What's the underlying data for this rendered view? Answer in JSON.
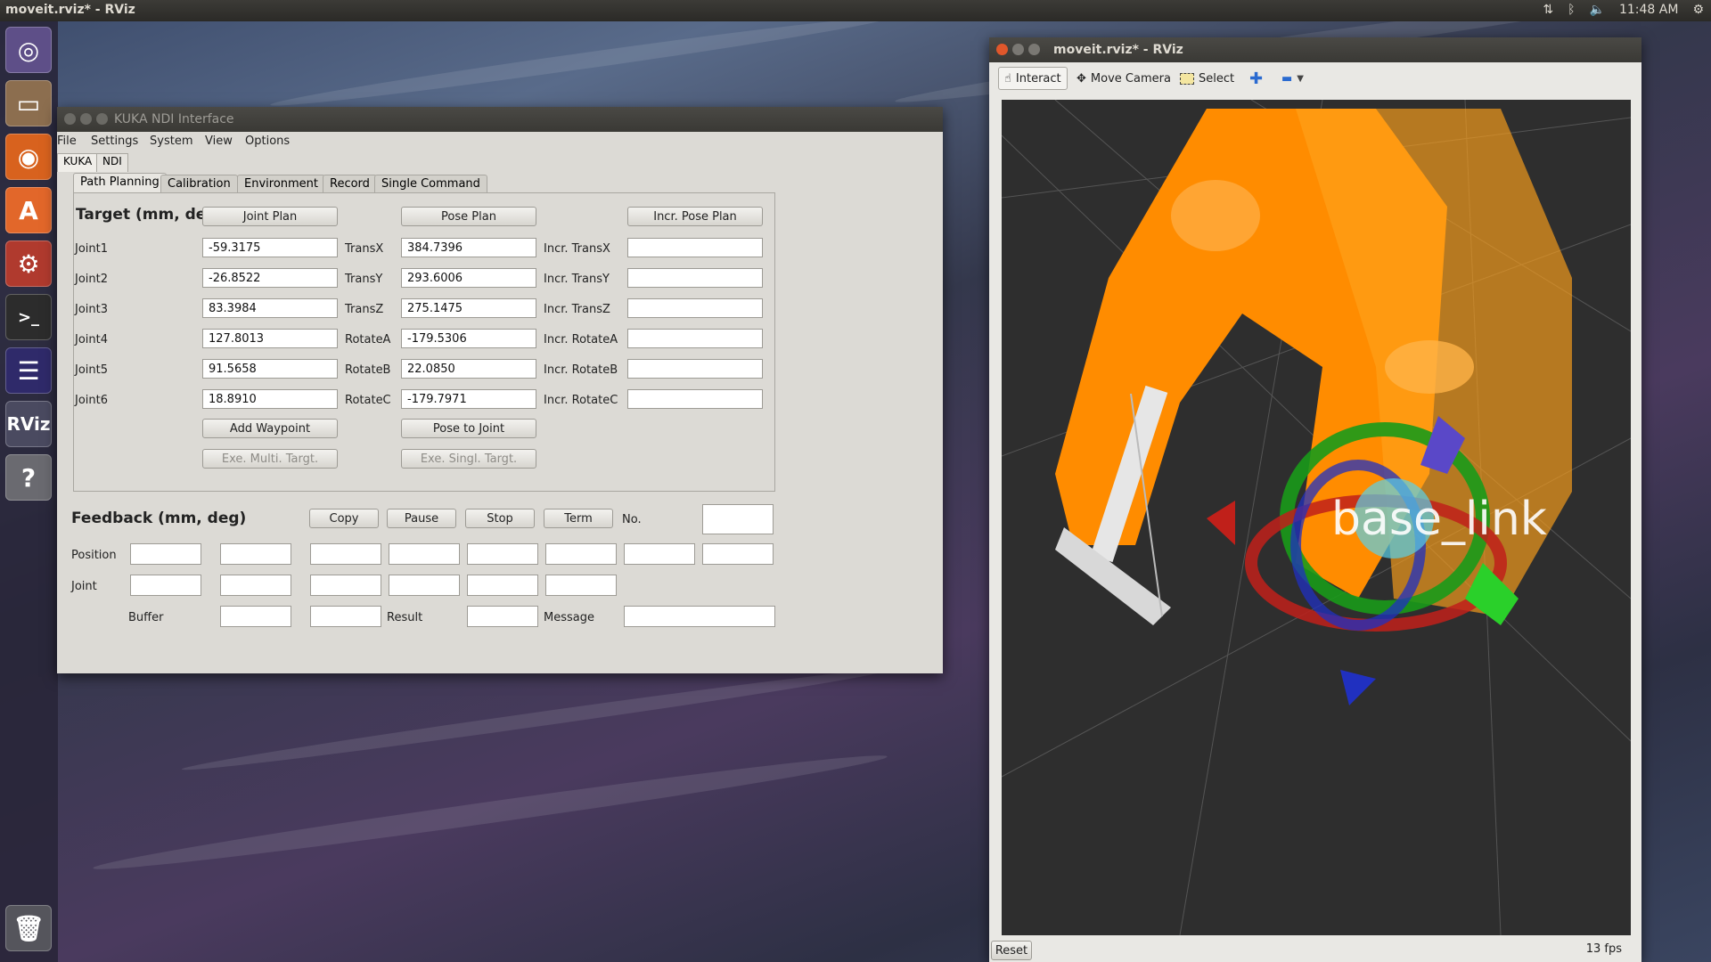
{
  "topbar": {
    "active_app": "moveit.rviz* - RViz",
    "clock": "11:48 AM"
  },
  "launcher": {
    "rviz_label": "RViz",
    "help_label": "?"
  },
  "kuka_window": {
    "title": "KUKA NDI Interface",
    "menu": [
      "File",
      "Settings",
      "System",
      "View",
      "Options"
    ],
    "top_tabs": [
      "KUKA",
      "NDI"
    ],
    "sub_tabs": [
      "Path Planning",
      "Calibration",
      "Environment",
      "Record",
      "Single Command"
    ],
    "target": {
      "heading": "Target (mm, de",
      "joint_plan_button": "Joint Plan",
      "pose_plan_button": "Pose Plan",
      "incr_pose_plan_button": "Incr. Pose Plan",
      "rows": [
        {
          "joint_label": "Joint1",
          "joint_value": "-59.3175",
          "pose_label": "TransX",
          "pose_value": "384.7396",
          "incr_label": "Incr. TransX",
          "incr_value": ""
        },
        {
          "joint_label": "Joint2",
          "joint_value": "-26.8522",
          "pose_label": "TransY",
          "pose_value": "293.6006",
          "incr_label": "Incr. TransY",
          "incr_value": ""
        },
        {
          "joint_label": "Joint3",
          "joint_value": "83.3984",
          "pose_label": "TransZ",
          "pose_value": "275.1475",
          "incr_label": "Incr. TransZ",
          "incr_value": ""
        },
        {
          "joint_label": "Joint4",
          "joint_value": "127.8013",
          "pose_label": "RotateA",
          "pose_value": "-179.5306",
          "incr_label": "Incr. RotateA",
          "incr_value": ""
        },
        {
          "joint_label": "Joint5",
          "joint_value": "91.5658",
          "pose_label": "RotateB",
          "pose_value": "22.0850",
          "incr_label": "Incr. RotateB",
          "incr_value": ""
        },
        {
          "joint_label": "Joint6",
          "joint_value": "18.8910",
          "pose_label": "RotateC",
          "pose_value": "-179.7971",
          "incr_label": "Incr. RotateC",
          "incr_value": ""
        }
      ],
      "add_waypoint_button": "Add Waypoint",
      "pose_to_joint_button": "Pose to Joint",
      "exe_multi_button": "Exe. Multi. Targt.",
      "exe_single_button": "Exe. Singl. Targt."
    },
    "feedback": {
      "heading": "Feedback (mm, deg)",
      "copy_button": "Copy",
      "pause_button": "Pause",
      "stop_button": "Stop",
      "term_button": "Term",
      "no_label": "No.",
      "position_label": "Position",
      "joint_label": "Joint",
      "buffer_label": "Buffer",
      "result_label": "Result",
      "message_label": "Message"
    }
  },
  "rviz_window": {
    "title": "moveit.rviz* - RViz",
    "tools": {
      "interact": "Interact",
      "move_camera": "Move Camera",
      "select": "Select"
    },
    "overlay_text": "base_link",
    "reset_button": "Reset",
    "fps": "13 fps"
  },
  "colors": {
    "robot_orange": "#ff8c00",
    "viewport_bg": "#2e2e2e",
    "panel_bg": "#dcdad5"
  }
}
